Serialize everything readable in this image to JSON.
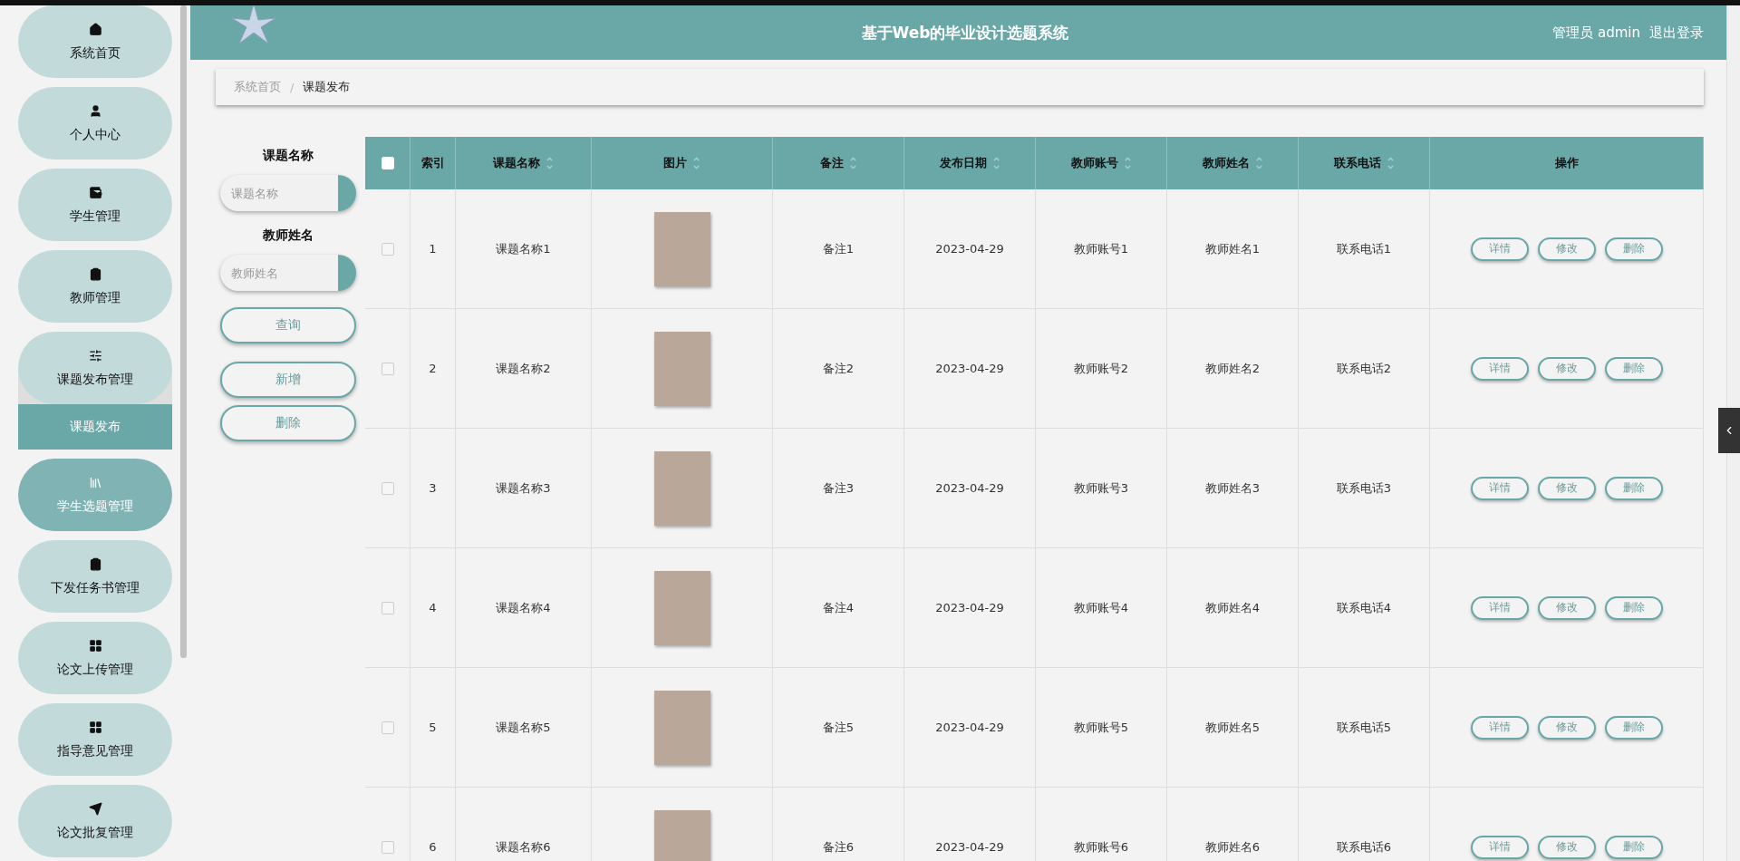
{
  "sidebar": {
    "items": [
      {
        "label": "系统首页",
        "hovered": false
      },
      {
        "label": "个人中心",
        "hovered": false
      },
      {
        "label": "学生管理",
        "hovered": false
      },
      {
        "label": "教师管理",
        "hovered": false
      },
      {
        "label": "课题发布管理",
        "hovered": false,
        "expanded": true,
        "children": [
          {
            "label": "课题发布",
            "selected": true
          }
        ]
      },
      {
        "label": "学生选题管理",
        "hovered": true
      },
      {
        "label": "下发任务书管理",
        "hovered": false
      },
      {
        "label": "论文上传管理",
        "hovered": false
      },
      {
        "label": "指导意见管理",
        "hovered": false
      },
      {
        "label": "论文批复管理",
        "hovered": false
      }
    ]
  },
  "header": {
    "title": "基于Web的毕业设计选题系统",
    "user": "管理员 admin",
    "logout": "退出登录"
  },
  "breadcrumb": {
    "separator": "/",
    "items": [
      {
        "label": "系统首页",
        "selected": false
      },
      {
        "label": "课题发布",
        "selected": true
      }
    ]
  },
  "search": {
    "fields": [
      {
        "label": "课题名称",
        "placeholder": "课题名称"
      },
      {
        "label": "教师姓名",
        "placeholder": "教师姓名"
      }
    ],
    "buttons": [
      "查询",
      "新增",
      "删除"
    ]
  },
  "table": {
    "columns": [
      {
        "kind": "checkbox",
        "checked": false
      },
      {
        "kind": "text",
        "label": "索引",
        "sortable": false
      },
      {
        "kind": "text",
        "label": "课题名称",
        "sortable": true
      },
      {
        "kind": "text",
        "label": "图片",
        "sortable": true
      },
      {
        "kind": "text",
        "label": "备注",
        "sortable": true
      },
      {
        "kind": "text",
        "label": "发布日期",
        "sortable": true
      },
      {
        "kind": "text",
        "label": "教师账号",
        "sortable": true
      },
      {
        "kind": "text",
        "label": "教师姓名",
        "sortable": true
      },
      {
        "kind": "text",
        "label": "联系电话",
        "sortable": true
      },
      {
        "kind": "text",
        "label": "操作",
        "sortable": false
      }
    ],
    "rows": [
      {
        "checked": false,
        "index": "1",
        "name": "课题名称1",
        "note": "备注1",
        "date": "2023-04-29",
        "account": "教师账号1",
        "teacher": "教师姓名1",
        "phone": "联系电话1",
        "actions": [
          "详情",
          "修改",
          "删除"
        ]
      },
      {
        "checked": false,
        "index": "2",
        "name": "课题名称2",
        "note": "备注2",
        "date": "2023-04-29",
        "account": "教师账号2",
        "teacher": "教师姓名2",
        "phone": "联系电话2",
        "actions": [
          "详情",
          "修改",
          "删除"
        ]
      },
      {
        "checked": false,
        "index": "3",
        "name": "课题名称3",
        "note": "备注3",
        "date": "2023-04-29",
        "account": "教师账号3",
        "teacher": "教师姓名3",
        "phone": "联系电话3",
        "actions": [
          "详情",
          "修改",
          "删除"
        ]
      },
      {
        "checked": false,
        "index": "4",
        "name": "课题名称4",
        "note": "备注4",
        "date": "2023-04-29",
        "account": "教师账号4",
        "teacher": "教师姓名4",
        "phone": "联系电话4",
        "actions": [
          "详情",
          "修改",
          "删除"
        ]
      },
      {
        "checked": false,
        "index": "5",
        "name": "课题名称5",
        "note": "备注5",
        "date": "2023-04-29",
        "account": "教师账号5",
        "teacher": "教师姓名5",
        "phone": "联系电话5",
        "actions": [
          "详情",
          "修改",
          "删除"
        ]
      },
      {
        "checked": false,
        "index": "6",
        "name": "课题名称6",
        "note": "备注6",
        "date": "2023-04-29",
        "account": "教师账号6",
        "teacher": "教师姓名6",
        "phone": "联系电话6",
        "actions": [
          "详情",
          "修改",
          "删除"
        ]
      }
    ]
  }
}
